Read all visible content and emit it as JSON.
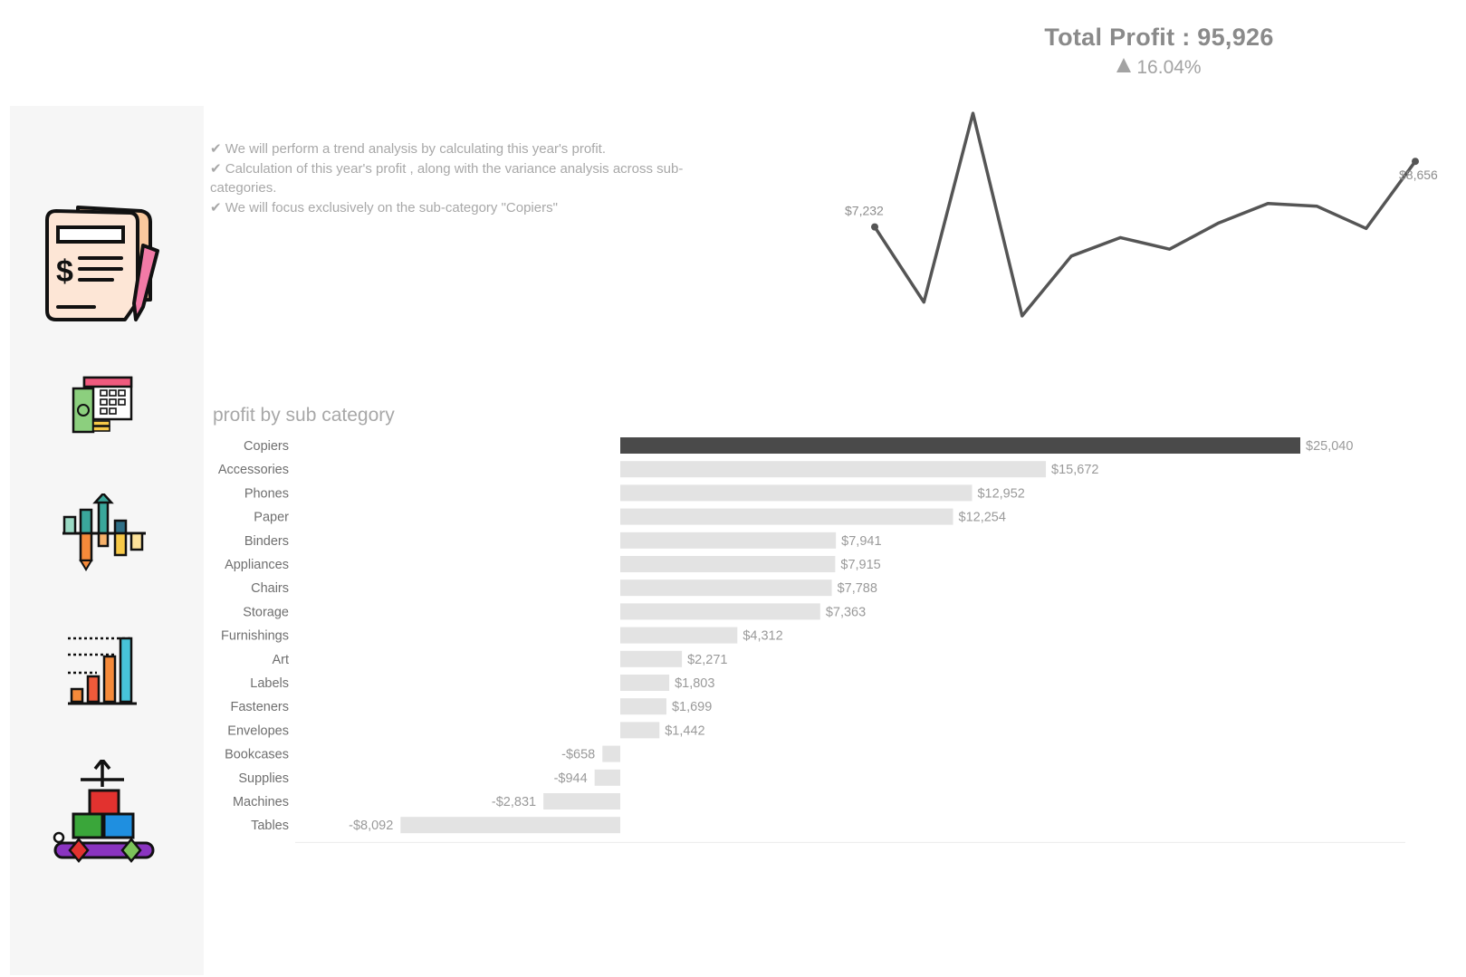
{
  "kpi": {
    "title": "Total Profit : 95,926",
    "change": "16.04%",
    "change_direction": "up"
  },
  "notes": [
    "✔ We will perform a trend analysis by calculating this year's profit.",
    "✔ Calculation of this year's profit , along with the variance analysis across sub-categories.",
    "✔ We will focus exclusively on the sub-category \"Copiers\""
  ],
  "sidebar": {
    "icons": [
      "invoice-document-icon",
      "calendar-money-icon",
      "bar-variance-icon",
      "growth-bar-chart-icon",
      "product-cubes-icon"
    ]
  },
  "chart_data": [
    {
      "type": "line",
      "title": "",
      "x": [
        1,
        2,
        3,
        4,
        5,
        6,
        7,
        8,
        9,
        10,
        11,
        12
      ],
      "values": [
        7232,
        5600,
        9700,
        5300,
        6600,
        7000,
        6750,
        7320,
        7740,
        7680,
        7200,
        8656
      ],
      "labels": [
        {
          "index": 0,
          "text": "$7,232"
        },
        {
          "index": 11,
          "text": "$8,656"
        }
      ],
      "ylim": [
        5200,
        9800
      ],
      "grid": false,
      "color": "#555555"
    },
    {
      "type": "bar",
      "orientation": "horizontal",
      "title": "profit  by sub category",
      "categories": [
        "Copiers",
        "Accessories",
        "Phones",
        "Paper",
        "Binders",
        "Appliances",
        "Chairs",
        "Storage",
        "Furnishings",
        "Art",
        "Labels",
        "Fasteners",
        "Envelopes",
        "Bookcases",
        "Supplies",
        "Machines",
        "Tables"
      ],
      "values": [
        25040,
        15672,
        12952,
        12254,
        7941,
        7915,
        7788,
        7363,
        4312,
        2271,
        1803,
        1699,
        1442,
        -658,
        -944,
        -2831,
        -8092
      ],
      "value_labels": [
        "$25,040",
        "$15,672",
        "$12,952",
        "$12,254",
        "$7,941",
        "$7,915",
        "$7,788",
        "$7,363",
        "$4,312",
        "$2,271",
        "$1,803",
        "$1,699",
        "$1,442",
        "-$658",
        "-$944",
        "-$2,831",
        "-$8,092"
      ],
      "highlight": "Copiers",
      "highlight_color": "#4a4a4a",
      "bar_color": "#e3e3e3",
      "xlim": [
        -12000,
        28000
      ],
      "grid": false
    }
  ]
}
